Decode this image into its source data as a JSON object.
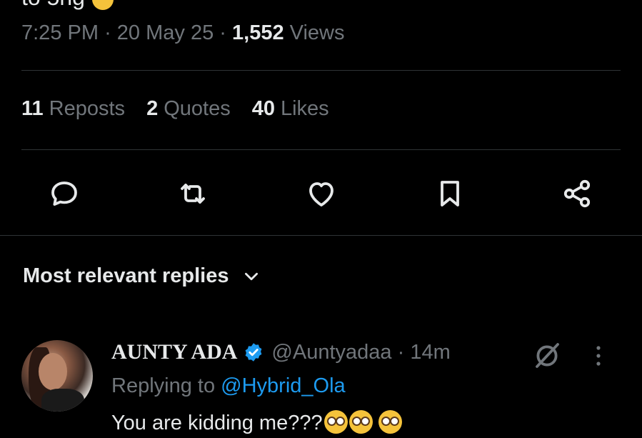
{
  "tweet": {
    "clipped_text": "to 5hg",
    "time": "7:25 PM",
    "date": "20 May 25",
    "views_count": "1,552",
    "views_label": "Views",
    "separator": "·"
  },
  "stats": {
    "reposts_count": "11",
    "reposts_label": "Reposts",
    "quotes_count": "2",
    "quotes_label": "Quotes",
    "likes_count": "40",
    "likes_label": "Likes"
  },
  "actions": [
    {
      "icon": "reply-icon"
    },
    {
      "icon": "repost-icon"
    },
    {
      "icon": "like-icon"
    },
    {
      "icon": "bookmark-icon"
    },
    {
      "icon": "share-icon"
    }
  ],
  "replies": {
    "header": "Most relevant replies",
    "items": [
      {
        "name": "AUNTY ADA",
        "handle": "@Auntyadaa",
        "time": "14m",
        "replying_to_label": "Replying to",
        "replying_to": "@Hybrid_Ola",
        "text": "You are kidding me???"
      }
    ]
  },
  "colors": {
    "background": "#000000",
    "primary_text": "#e7e9ea",
    "secondary_text": "#71767b",
    "divider": "#2f3336",
    "accent": "#1d9bf0"
  }
}
